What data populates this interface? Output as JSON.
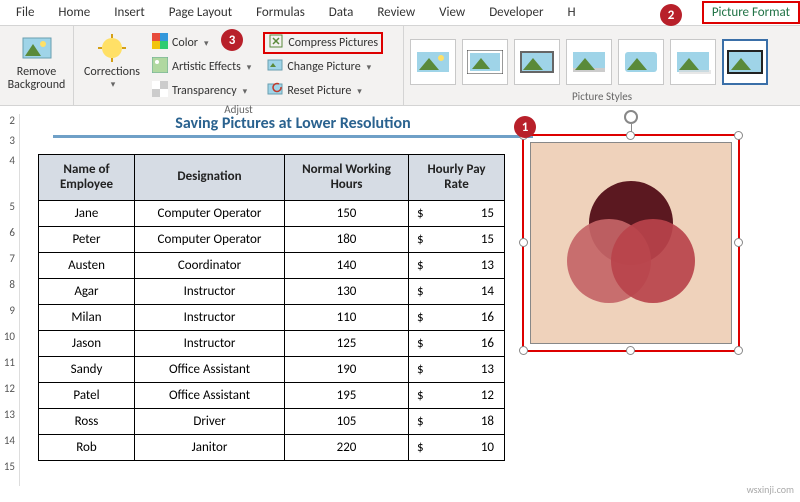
{
  "tabs": {
    "file": "File",
    "home": "Home",
    "insert": "Insert",
    "page_layout": "Page Layout",
    "formulas": "Formulas",
    "data": "Data",
    "review": "Review",
    "view": "View",
    "developer": "Developer",
    "help_initial": "H",
    "picture_format": "Picture Format"
  },
  "ribbon": {
    "groups": {
      "background": {
        "remove": "Remove\nBackground"
      },
      "adjust": {
        "label": "Adjust",
        "corrections": "Corrections",
        "color": "Color",
        "artistic": "Artistic Effects",
        "transparency": "Transparency",
        "compress": "Compress Pictures",
        "change": "Change Picture",
        "reset": "Reset Picture"
      },
      "styles": {
        "label": "Picture Styles"
      }
    }
  },
  "badges": {
    "b1": "1",
    "b2": "2",
    "b3": "3"
  },
  "sheet": {
    "title": "Saving Pictures at Lower Resolution",
    "rows": [
      "2",
      "3",
      "4",
      "5",
      "6",
      "7",
      "8",
      "9",
      "10",
      "11",
      "12",
      "13",
      "14",
      "15"
    ],
    "headers": {
      "name": "Name of Employee",
      "desig": "Designation",
      "hours": "Normal Working Hours",
      "rate": "Hourly Pay Rate"
    },
    "data": [
      {
        "name": "Jane",
        "desig": "Computer Operator",
        "hours": "150",
        "rate": "15"
      },
      {
        "name": "Peter",
        "desig": "Computer Operator",
        "hours": "180",
        "rate": "15"
      },
      {
        "name": "Austen",
        "desig": "Coordinator",
        "hours": "140",
        "rate": "13"
      },
      {
        "name": "Agar",
        "desig": "Instructor",
        "hours": "130",
        "rate": "14"
      },
      {
        "name": "Milan",
        "desig": "Instructor",
        "hours": "110",
        "rate": "16"
      },
      {
        "name": "Jason",
        "desig": "Instructor",
        "hours": "125",
        "rate": "16"
      },
      {
        "name": "Sandy",
        "desig": "Office Assistant",
        "hours": "190",
        "rate": "13"
      },
      {
        "name": "Patel",
        "desig": "Office Assistant",
        "hours": "195",
        "rate": "12"
      },
      {
        "name": "Ross",
        "desig": "Driver",
        "hours": "105",
        "rate": "18"
      },
      {
        "name": "Rob",
        "desig": "Janitor",
        "hours": "220",
        "rate": "10"
      }
    ]
  },
  "watermark": "wsxinji.com"
}
